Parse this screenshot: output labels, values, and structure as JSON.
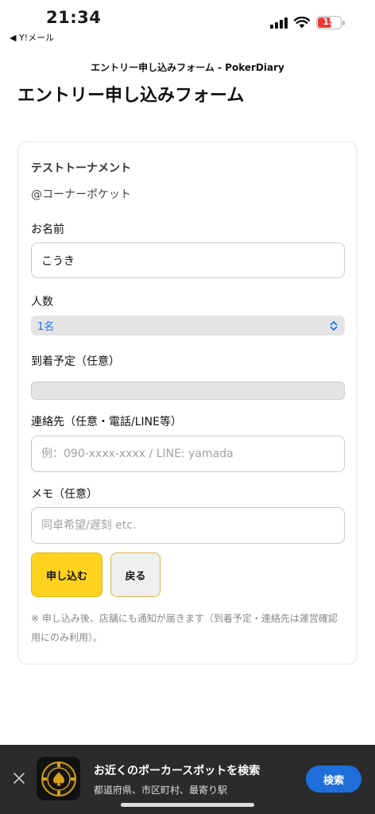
{
  "status_bar": {
    "time": "21:34",
    "back_app": "◀ Y!メール",
    "battery": "15"
  },
  "tab_title": "エントリー申し込みフォーム - PokerDiary",
  "heading": "エントリー申し込みフォーム",
  "form": {
    "tournament": "テストトーナメント",
    "venue": "@コーナーポケット",
    "name_label": "お名前",
    "name_value": "こうき",
    "people_label": "人数",
    "people_value": "1名",
    "arrival_label": "到着予定（任意）",
    "contact_label": "連絡先（任意・電話/LINE等）",
    "contact_placeholder": "例：090-xxxx-xxxx / LINE: yamada",
    "memo_label": "メモ（任意）",
    "memo_placeholder": "同卓希望/遅刻 etc.",
    "submit_label": "申し込む",
    "back_label": "戻る",
    "note": "※ 申し込み後、店舗にも通知が届きます（到着予定・連絡先は運営確認用にのみ利用）。"
  },
  "banner": {
    "title": "お近くのポーカースポットを検索",
    "subtitle": "都道府県、市区町村、最寄り駅",
    "search_label": "検索"
  },
  "colors": {
    "accent_yellow": "#ffd21f",
    "link_blue": "#1a73e8",
    "banner_button": "#1e6fd9",
    "battery_red": "#ea3a3a"
  }
}
